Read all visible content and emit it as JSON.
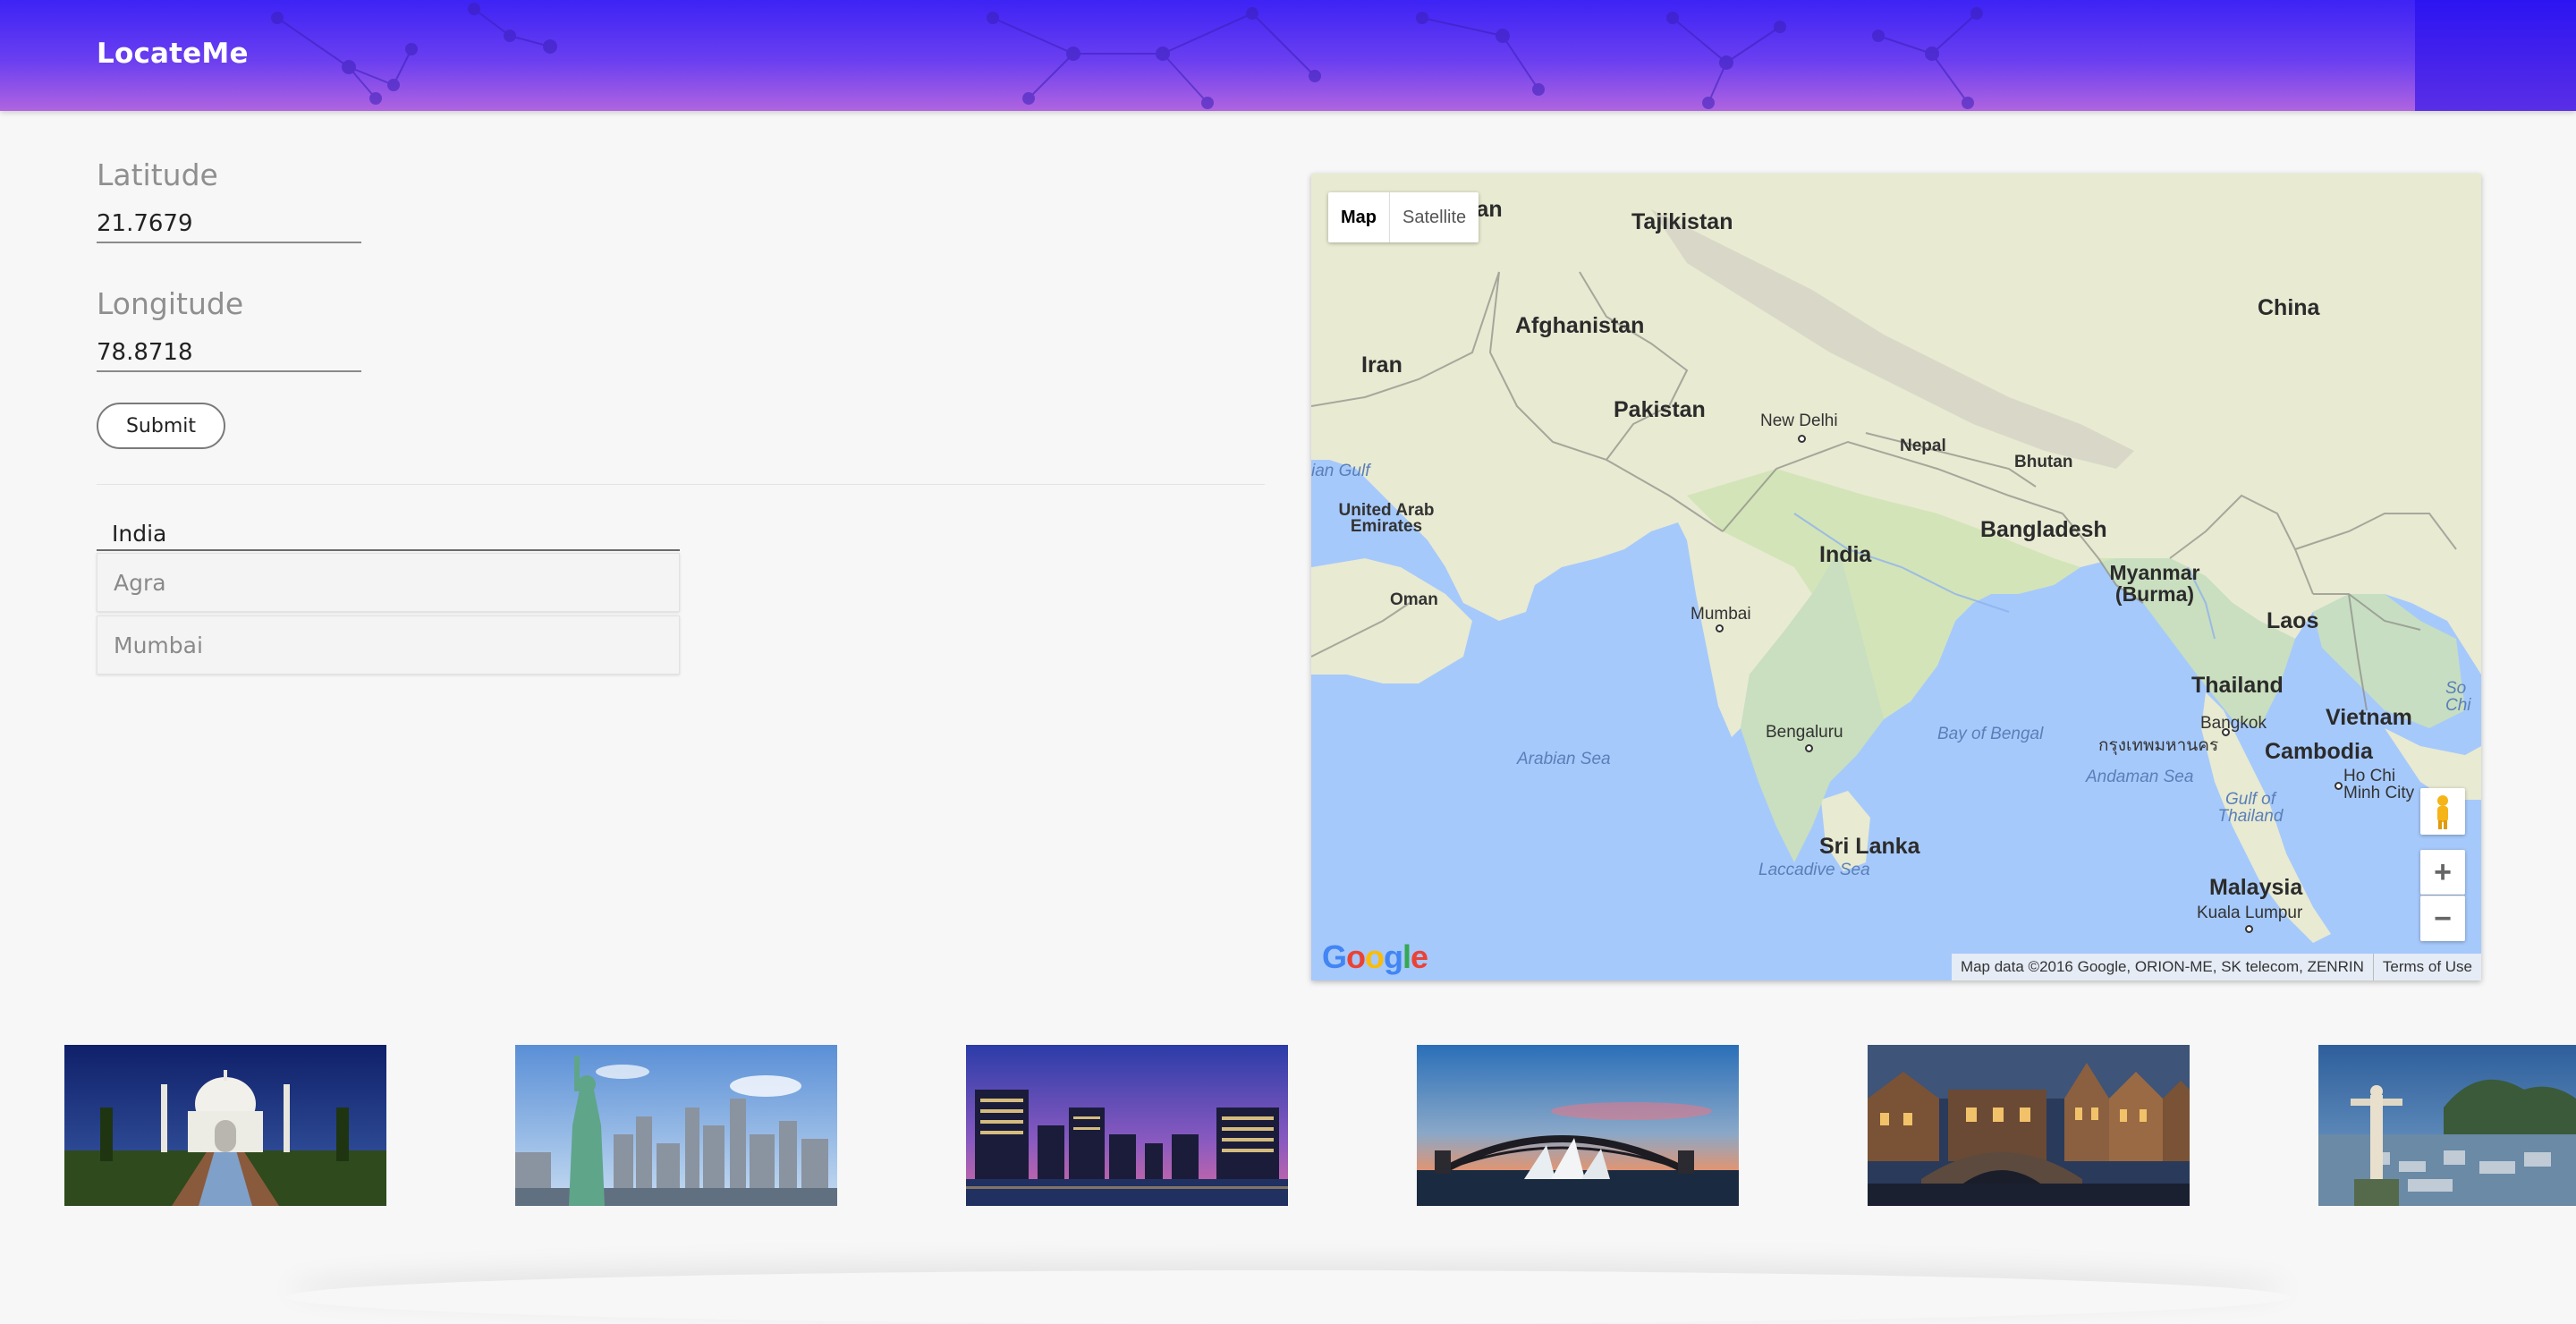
{
  "header": {
    "brand": "LocateMe"
  },
  "form": {
    "latitude_label": "Latitude",
    "latitude_value": "21.7679",
    "longitude_label": "Longitude",
    "longitude_value": "78.8718",
    "submit_label": "Submit"
  },
  "autocomplete": {
    "value": "India",
    "suggestions": [
      "Agra",
      "Mumbai"
    ]
  },
  "map": {
    "type_controls": [
      "Map",
      "Satellite"
    ],
    "active_type": "Map",
    "countries": [
      "Tajikistan",
      "Afghanistan",
      "Iran",
      "Pakistan",
      "China",
      "Nepal",
      "Bhutan",
      "Bangladesh",
      "India",
      "United Arab Emirates",
      "Oman",
      "Myanmar (Burma)",
      "Laos",
      "Thailand",
      "Vietnam",
      "Cambodia",
      "Sri Lanka",
      "Malaysia"
    ],
    "cities": [
      "New Delhi",
      "Mumbai",
      "Bengaluru",
      "Bangkok",
      "Ho Chi Minh City",
      "Kuala Lumpur"
    ],
    "thai_label": "กรุงเทพมหานคร",
    "water": [
      "Arabian Sea",
      "Bay of Bengal",
      "Andaman Sea",
      "Gulf of Thailand",
      "Laccadive Sea",
      "ian Gulf",
      "So Chi"
    ],
    "partial_country": "nistan",
    "zoom_in": "+",
    "zoom_out": "−",
    "logo": "Google",
    "attribution": "Map data ©2016 Google, ORION-ME, SK telecom, ZENRIN",
    "terms": "Terms of Use"
  },
  "gallery": {
    "items": [
      "taj-mahal",
      "statue-of-liberty",
      "city-skyline-at-dusk",
      "sydney-harbour-bridge",
      "old-town-bridge-at-night",
      "christ-the-redeemer"
    ]
  },
  "colors": {
    "header_start": "#3d23f5",
    "header_end": "#b064e0",
    "water": "#a6c9fb",
    "land": "#e9ecd6"
  }
}
